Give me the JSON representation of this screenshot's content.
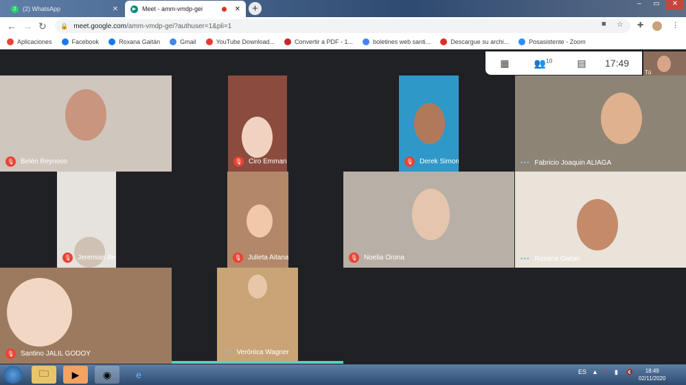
{
  "browser": {
    "tabs": [
      {
        "title": "(2) WhatsApp",
        "badge": "2",
        "active": false
      },
      {
        "title": "Meet - amm-vmdp-gei",
        "active": true
      }
    ],
    "new_tab": "+",
    "window_controls": [
      "–",
      "▭",
      "✕"
    ],
    "url_host": "meet.google.com",
    "url_path": "/amm-vmdp-gei?authuser=1&pli=1"
  },
  "bookmarks": [
    {
      "label": "Aplicaciones",
      "icon": "apps-icon",
      "color": "#ea4335"
    },
    {
      "label": "Facebook",
      "icon": "facebook-icon",
      "color": "#1877f2"
    },
    {
      "label": "Roxana Gaitán",
      "icon": "facebook-icon",
      "color": "#1877f2"
    },
    {
      "label": "Gmail",
      "icon": "google-icon",
      "color": "#4285f4"
    },
    {
      "label": "YouTube Download...",
      "icon": "download-icon",
      "color": "#e53935"
    },
    {
      "label": "Convertir a PDF - 1...",
      "icon": "pdf-icon",
      "color": "#c62828"
    },
    {
      "label": "boletines web santi...",
      "icon": "google-icon",
      "color": "#4285f4"
    },
    {
      "label": "Descargue su archi...",
      "icon": "no-icon",
      "color": "#d93025"
    },
    {
      "label": "Posasistente - Zoom",
      "icon": "zoom-icon",
      "color": "#2d8cff"
    }
  ],
  "meet": {
    "participants_count": "10",
    "time": "17:49",
    "self_label": "Tú",
    "participants": [
      {
        "name": "Belén Reynoso",
        "muted": true
      },
      {
        "name": "Ciro Emmanuel BARRERA CORREA",
        "muted": true
      },
      {
        "name": "Derek Simon Aquiles GIACOBBE",
        "muted": true
      },
      {
        "name": "Fabricio Joaquin ALIAGA",
        "muted": false
      },
      {
        "name": "Jeremias Benjamin SANCHEZ",
        "muted": true
      },
      {
        "name": "Julieta Aitana LUDUE�A",
        "muted": true
      },
      {
        "name": "Noelia Orona",
        "muted": true
      },
      {
        "name": "Roxana Gaitan",
        "muted": false
      },
      {
        "name": "Santino JALIL GODOY",
        "muted": true
      },
      {
        "name": "Verónica Wagner",
        "muted": false
      }
    ]
  },
  "taskbar": {
    "lang": "ES",
    "time": "18:49",
    "date": "02/11/2020"
  }
}
